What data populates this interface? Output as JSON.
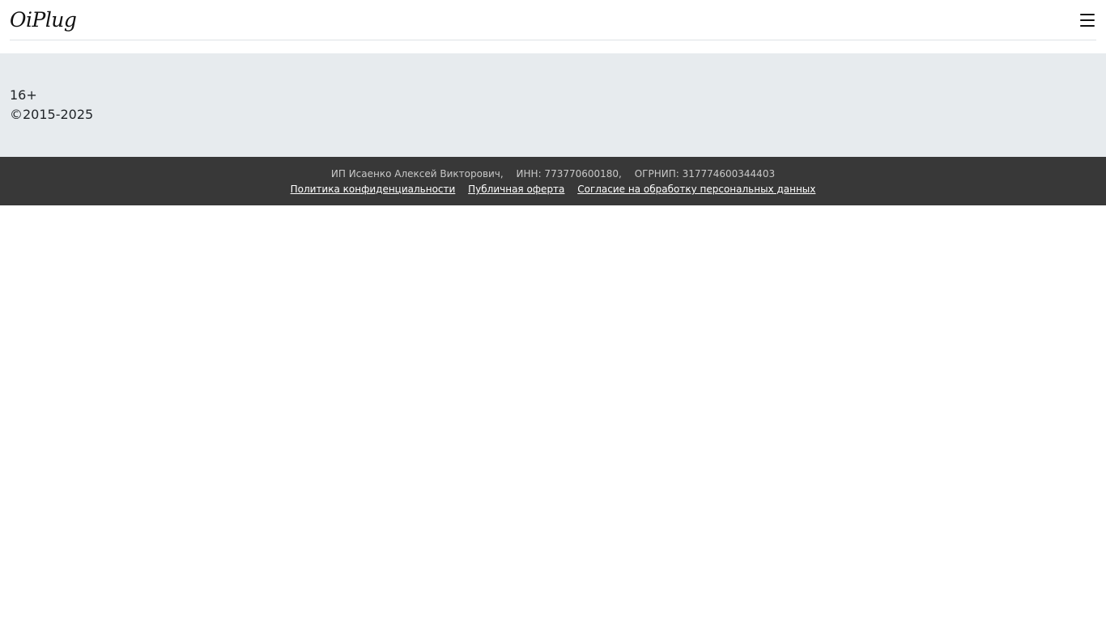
{
  "header": {
    "logo_text": "OiPlug",
    "menu_icon": "hamburger-menu-icon"
  },
  "info": {
    "age_rating": "16+",
    "copyright": "©2015-2025"
  },
  "legal": {
    "owner": "ИП Исаенко Алексей Викторович,",
    "inn": "ИНН: 773770600180,",
    "ogrnip": "ОГРНИП: 317774600344403",
    "links": [
      "Политика конфиденциальности",
      "Публичная оферта",
      "Согласие на обработку персональных данных"
    ]
  },
  "colors": {
    "info_band_bg": "#e7ebee",
    "legal_bar_bg": "#383838"
  }
}
